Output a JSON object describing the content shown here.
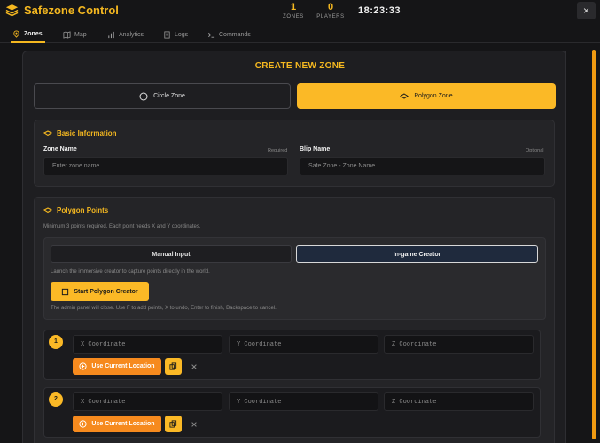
{
  "app": {
    "title": "Safezone Control",
    "time": "18:23:33",
    "close_icon": "×"
  },
  "stats": [
    {
      "value": "1",
      "label": "ZONES"
    },
    {
      "value": "0",
      "label": "PLAYERS"
    }
  ],
  "tabs": [
    {
      "label": "Zones",
      "icon": "map-pin-icon",
      "active": true
    },
    {
      "label": "Map",
      "icon": "map-icon"
    },
    {
      "label": "Analytics",
      "icon": "bar-chart-icon"
    },
    {
      "label": "Logs",
      "icon": "document-icon"
    },
    {
      "label": "Commands",
      "icon": "terminal-icon"
    }
  ],
  "main": {
    "title": "CREATE NEW ZONE",
    "zone_types": [
      {
        "label": "Circle Zone",
        "icon": "circle-icon"
      },
      {
        "label": "Polygon Zone",
        "icon": "polygon-icon",
        "selected": true
      }
    ],
    "basic_info": {
      "title": "Basic Information",
      "zone_name": {
        "label": "Zone Name",
        "note": "Required",
        "placeholder": "Enter zone name..."
      },
      "blip_name": {
        "label": "Blip Name",
        "note": "Optional",
        "placeholder": "Safe Zone - Zone Name"
      }
    },
    "polygon": {
      "title": "Polygon Points",
      "hint": "Minimum 3 points required. Each point needs X and Y coordinates.",
      "modes": [
        {
          "label": "Manual Input"
        },
        {
          "label": "In-game Creator",
          "selected": true
        }
      ],
      "creator_hint": "Launch the immersive creator to capture points directly in the world.",
      "start_label": "Start Polygon Creator",
      "creator_note": "The admin panel will close. Use F to add points, X to undo, Enter to finish, Backspace to cancel.",
      "points": [
        {
          "number": "1",
          "x_placeholder": "X Coordinate",
          "y_placeholder": "Y Coordinate",
          "z_placeholder": "Z Coordinate",
          "use_label": "Use Current Location"
        },
        {
          "number": "2",
          "x_placeholder": "X Coordinate",
          "y_placeholder": "Y Coordinate",
          "z_placeholder": "Z Coordinate",
          "use_label": "Use Current Location"
        }
      ]
    }
  },
  "colors": {
    "accent": "#f5b820",
    "button_yellow": "#fbb926",
    "button_orange": "#f68a1e",
    "background": "#151517",
    "panel": "#1e1e21"
  }
}
